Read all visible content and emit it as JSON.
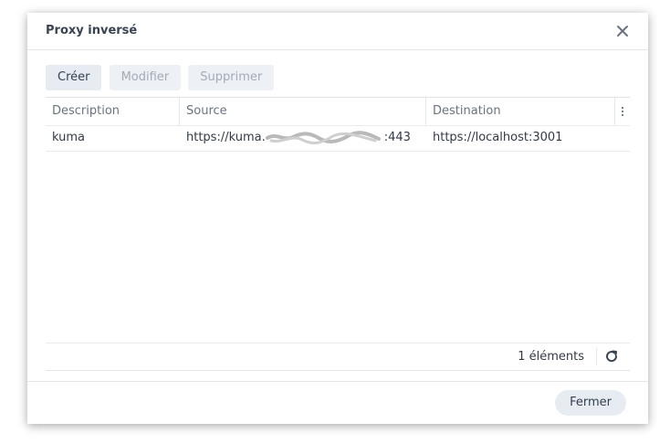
{
  "dialog": {
    "title": "Proxy inversé",
    "close_icon": "close-icon"
  },
  "toolbar": {
    "create_label": "Créer",
    "edit_label": "Modifier",
    "delete_label": "Supprimer"
  },
  "table": {
    "columns": [
      "Description",
      "Source",
      "Destination"
    ],
    "column_menu_icon": "more-vertical-icon",
    "rows": [
      {
        "description": "kuma",
        "source": "https://kuma.",
        "source_suffix": ":443",
        "destination": "https://localhost:3001"
      }
    ]
  },
  "footer": {
    "count": "1 éléments",
    "refresh_icon": "refresh-icon"
  },
  "actions": {
    "close_label": "Fermer"
  }
}
